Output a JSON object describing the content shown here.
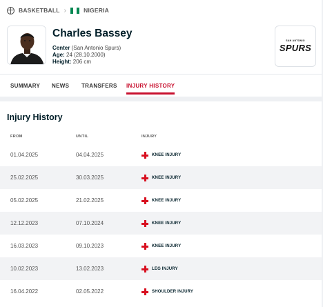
{
  "breadcrumb": {
    "sport": "BASKETBALL",
    "country": "NIGERIA",
    "flag_colors": [
      "#008751",
      "#ffffff",
      "#008751"
    ]
  },
  "player": {
    "name": "Charles Bassey",
    "position_label": "Center",
    "team": "(San Antonio Spurs)",
    "age_label": "Age:",
    "age_value": "24 (28.10.2000)",
    "height_label": "Height:",
    "height_value": "206 cm"
  },
  "team_logo": {
    "top_text": "SAN ANTONIO",
    "main_text": "SPURS"
  },
  "tabs": [
    {
      "label": "SUMMARY"
    },
    {
      "label": "NEWS"
    },
    {
      "label": "TRANSFERS"
    },
    {
      "label": "INJURY HISTORY",
      "active": true
    }
  ],
  "injury": {
    "title": "Injury History",
    "columns": [
      "FROM",
      "UNTIL",
      "INJURY"
    ],
    "rows": [
      {
        "from": "01.04.2025",
        "until": "04.04.2025",
        "injury": "KNEE INJURY"
      },
      {
        "from": "25.02.2025",
        "until": "30.03.2025",
        "injury": "KNEE INJURY"
      },
      {
        "from": "05.02.2025",
        "until": "21.02.2025",
        "injury": "KNEE INJURY"
      },
      {
        "from": "12.12.2023",
        "until": "07.10.2024",
        "injury": "KNEE INJURY"
      },
      {
        "from": "16.03.2023",
        "until": "09.10.2023",
        "injury": "KNEE INJURY"
      },
      {
        "from": "10.02.2023",
        "until": "13.02.2023",
        "injury": "LEG INJURY"
      },
      {
        "from": "16.04.2022",
        "until": "02.05.2022",
        "injury": "SHOULDER INJURY"
      }
    ]
  },
  "colors": {
    "accent": "#c8102e",
    "injury_icon": "#d80f1f",
    "heading": "#001e28"
  }
}
